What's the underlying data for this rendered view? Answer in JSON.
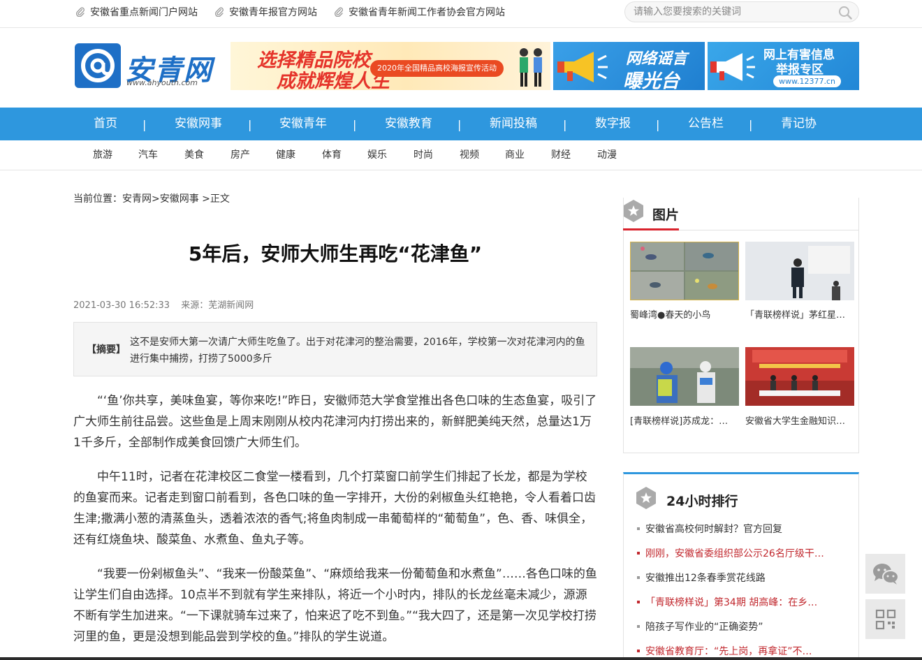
{
  "topbar": {
    "links": [
      "安徽省重点新闻门户网站",
      "安徽青年报官方网站",
      "安徽省青年新闻工作者协会官方网站"
    ],
    "search_placeholder": "请输入您要搜索的关键词"
  },
  "logo": {
    "name": "安青网",
    "url_text": "www.ahyouth.com"
  },
  "banners": {
    "banner1_main": "选择精品院校",
    "banner1_sub": "成就辉煌人生",
    "banner1_tag": "2020年全国精品高校海报宣传活动",
    "banner2_line1": "网络谣言",
    "banner2_line2": "曝光台",
    "banner3_line1": "网上有害信息",
    "banner3_line2": "举报专区",
    "banner3_url": "www.12377.cn"
  },
  "mainnav": [
    "首页",
    "安徽网事",
    "安徽青年",
    "安徽教育",
    "新闻投稿",
    "数字报",
    "公告栏",
    "青记协"
  ],
  "nav_separator": "|",
  "subnav": [
    "旅游",
    "汽车",
    "美食",
    "房产",
    "健康",
    "体育",
    "娱乐",
    "时尚",
    "视频",
    "商业",
    "财经",
    "动漫"
  ],
  "article": {
    "breadcrumb": "当前位置：安青网>安徽网事 >正文",
    "title": "5年后，安师大师生再吃“花津鱼”",
    "date": "2021-03-30 16:52:33",
    "source": "来源：芜湖新闻网",
    "summary_tag": "【摘要】",
    "summary": "这不是安师大第一次请广大师生吃鱼了。出于对花津河的整治需要，2016年，学校第一次对花津河内的鱼进行集中捕捞，打捞了5000多斤",
    "paragraphs": [
      "“‘鱼’你共享，美味鱼宴，等你来吃!”昨日，安徽师范大学食堂推出各色口味的生态鱼宴，吸引了广大师生前往品尝。这些鱼是上周末刚刚从校内花津河内打捞出来的，新鲜肥美纯天然，总量达1万1千多斤，全部制作成美食回馈广大师生们。",
      "中午11时，记者在花津校区二食堂一楼看到，几个打菜窗口前学生们排起了长龙，都是为学校的鱼宴而来。记者走到窗口前看到，各色口味的鱼一字排开，大份的剁椒鱼头红艳艳，令人看着口齿生津;撒满小葱的清蒸鱼头，透着浓浓的香气;将鱼肉制成一串葡萄样的“葡萄鱼”，色、香、味俱全，还有红烧鱼块、酸菜鱼、水煮鱼、鱼丸子等。",
      "“我要一份剁椒鱼头”、“我来一份酸菜鱼”、“麻烦给我来一份葡萄鱼和水煮鱼”……各色口味的鱼让学生们自由选择。10点半不到就有学生来排队，将近一个小时内，排队的长龙丝毫未减少，源源不断有学生加进来。“一下课就骑车过来了，怕来迟了吃不到鱼。”“我大四了，还是第一次见学校打捞河里的鱼，更是没想到能品尝到学校的鱼。”排队的学生说道。"
    ]
  },
  "sidebar": {
    "pictures_title": "图片",
    "pictures": [
      "蜀峰湾●春天的小鸟",
      "「青联榜样说」茅红星…",
      "[青联榜样说]苏成龙：…",
      "安徽省大学生金融知识…"
    ],
    "rank_title": "24小时排行",
    "rank": [
      {
        "text": "安徽省高校何时解封？官方回复",
        "hot": false
      },
      {
        "text": "刚刚，安徽省委组织部公示26名厅级干…",
        "hot": true
      },
      {
        "text": "安徽推出12条春季赏花线路",
        "hot": false
      },
      {
        "text": "「青联榜样说」第34期 胡高峰：在乡…",
        "hot": true
      },
      {
        "text": "陪孩子写作业的“正确姿势”",
        "hot": false
      },
      {
        "text": "安徽省教育厅：“先上岗，再拿证”不…",
        "hot": true
      }
    ]
  },
  "colors": {
    "nav_blue": "#2e97de",
    "accent_red": "#c1272d"
  }
}
